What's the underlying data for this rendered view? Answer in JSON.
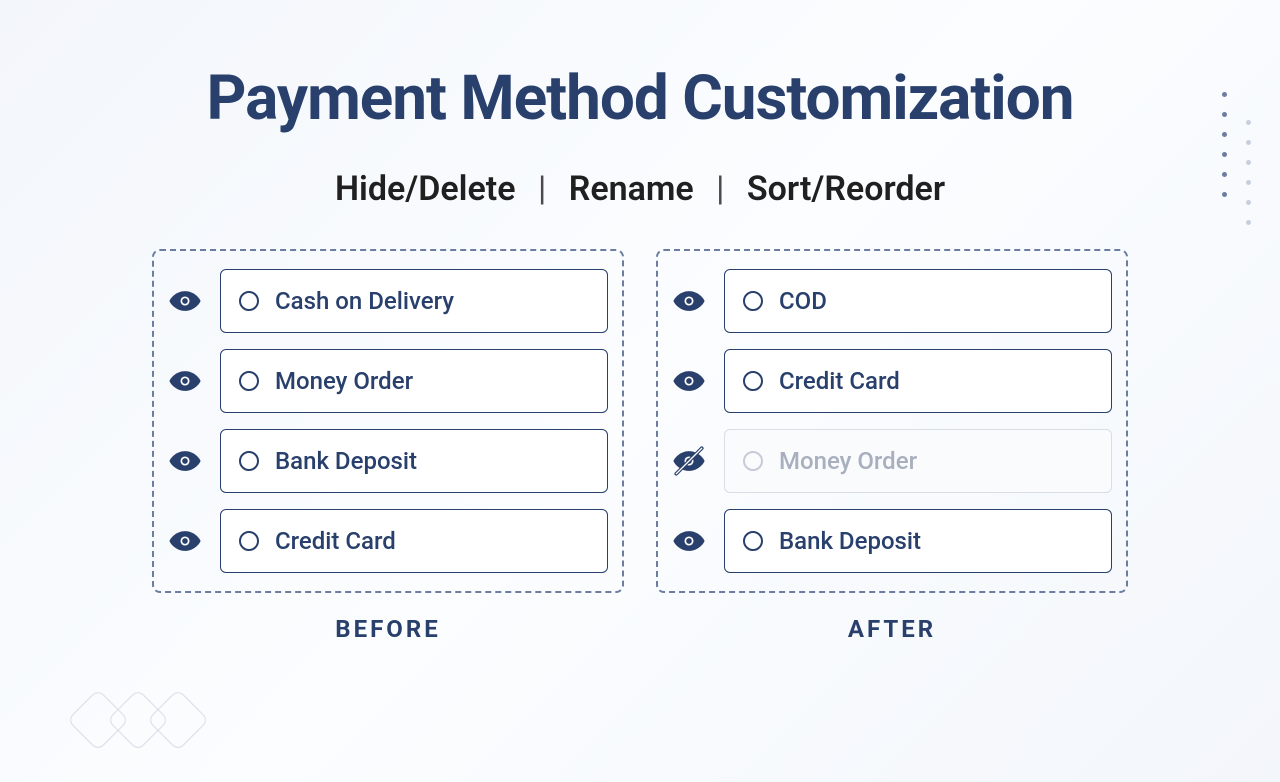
{
  "title": "Payment Method Customization",
  "subtitle_parts": [
    "Hide/Delete",
    "Rename",
    "Sort/Reorder"
  ],
  "before": {
    "caption": "BEFORE",
    "methods": [
      {
        "label": "Cash on Delivery",
        "visible": true
      },
      {
        "label": "Money Order",
        "visible": true
      },
      {
        "label": "Bank Deposit",
        "visible": true
      },
      {
        "label": "Credit Card",
        "visible": true
      }
    ]
  },
  "after": {
    "caption": "AFTER",
    "methods": [
      {
        "label": "COD",
        "visible": true
      },
      {
        "label": "Credit Card",
        "visible": true
      },
      {
        "label": "Money Order",
        "visible": false
      },
      {
        "label": "Bank Deposit",
        "visible": true
      }
    ]
  }
}
